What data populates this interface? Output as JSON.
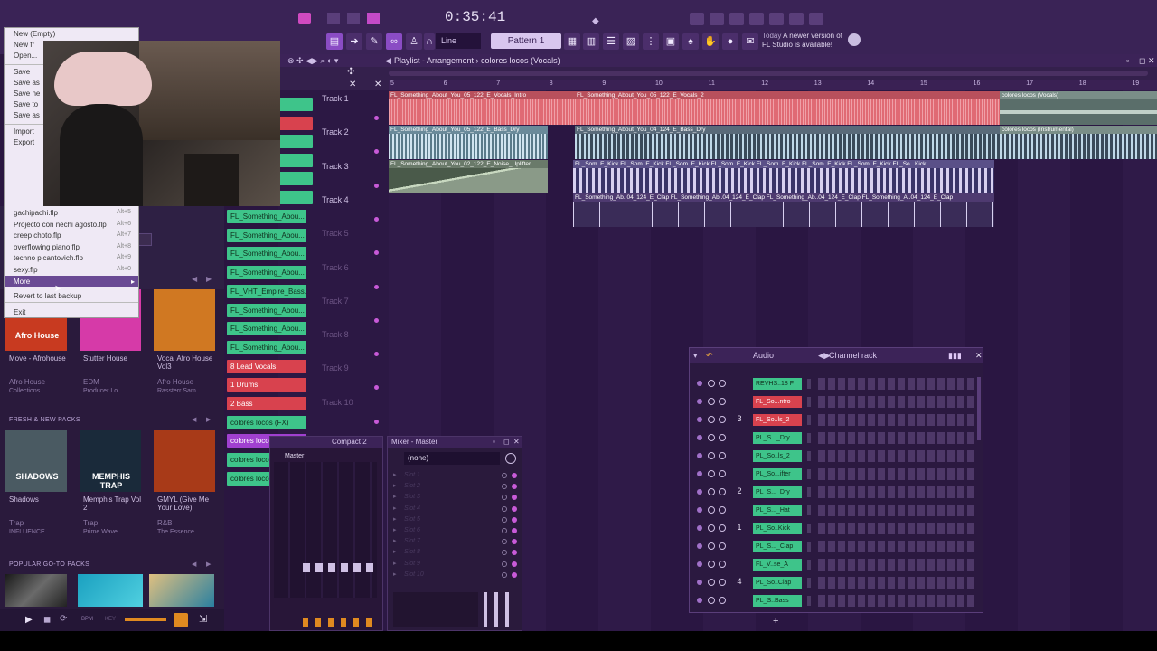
{
  "toolbar": {
    "time": "0:35:41",
    "pattern": "Pattern 1",
    "mode": "Line",
    "notice_line1": "Today",
    "notice_line2": "A newer version of",
    "notice_line3": "FL Studio is available!"
  },
  "file_menu": {
    "items": [
      {
        "label": "New (Empty)",
        "shortcut": ""
      },
      {
        "label": "New fr",
        "shortcut": ""
      },
      {
        "label": "Open...",
        "shortcut": ""
      },
      {
        "label": "Save",
        "shortcut": ""
      },
      {
        "label": "Save as",
        "shortcut": ""
      },
      {
        "label": "Save ne",
        "shortcut": ""
      },
      {
        "label": "Save to",
        "shortcut": ""
      },
      {
        "label": "Save as",
        "shortcut": ""
      },
      {
        "label": "Import",
        "shortcut": ""
      },
      {
        "label": "Export",
        "shortcut": ""
      }
    ],
    "recent": [
      {
        "label": "gachipachi.flp",
        "shortcut": "Alt+5"
      },
      {
        "label": "Projecto con nechi agosto.flp",
        "shortcut": "Alt+6"
      },
      {
        "label": "creep choto.flp",
        "shortcut": "Alt+7"
      },
      {
        "label": "overflowing piano.flp",
        "shortcut": "Alt+8"
      },
      {
        "label": "techno picantovich.flp",
        "shortcut": "Alt+9"
      },
      {
        "label": "sexy.flp",
        "shortcut": "Alt+0"
      }
    ],
    "more": "More",
    "revert": "Revert to last backup",
    "exit": "Exit"
  },
  "browser": {
    "packs_row1": [
      {
        "title": "Afro House",
        "name": "Move - Afrohouse",
        "genre": "Afro House",
        "sub": "Collections",
        "color": "#c83a20"
      },
      {
        "title": "",
        "name": "Stutter House",
        "genre": "EDM",
        "sub": "Producer Lo...",
        "color": "#d63aa8"
      },
      {
        "title": "",
        "name": "Vocal Afro House Vol3",
        "genre": "Afro House",
        "sub": "Rassterr Sam...",
        "color": "#d07822"
      }
    ],
    "fresh_header": "FRESH & NEW PACKS",
    "packs_row2": [
      {
        "title": "SHADOWS",
        "name": "Shadows",
        "genre": "Trap",
        "sub": "INFLUENCE",
        "color": "#4a5a62"
      },
      {
        "title": "MEMPHIS TRAP",
        "name": "Memphis Trap Vol 2",
        "genre": "Trap",
        "sub": "Prime Wave",
        "color": "#1a2a3a"
      },
      {
        "title": "",
        "name": "GMYL (Give Me Your Love)",
        "genre": "R&B",
        "sub": "The Essence",
        "color": "#a83a18"
      }
    ],
    "popular_header": "POPULAR GO-TO PACKS",
    "bpm": "BPM",
    "key": "KEY"
  },
  "channels": [
    {
      "label": "FL_Something_Abou...",
      "type": "green"
    },
    {
      "label": "FL_Something_Abou...",
      "type": "green"
    },
    {
      "label": "FL_Something_Abou...",
      "type": "green"
    },
    {
      "label": "FL_Something_Abou...",
      "type": "green"
    },
    {
      "label": "FL_VHT_Empire_Bass...",
      "type": "green"
    },
    {
      "label": "FL_Something_Abou...",
      "type": "green"
    },
    {
      "label": "FL_Something_Abou...",
      "type": "green"
    },
    {
      "label": "FL_Something_Abou...",
      "type": "green"
    },
    {
      "label": "8 Lead Vocals",
      "type": "red"
    },
    {
      "label": "1 Drums",
      "type": "red"
    },
    {
      "label": "2 Bass",
      "type": "red"
    },
    {
      "label": "colores locos (FX)",
      "type": "green"
    },
    {
      "label": "colores loco",
      "type": "purple"
    },
    {
      "label": "colores loco",
      "type": "green"
    },
    {
      "label": "colores loco",
      "type": "green"
    }
  ],
  "playlist": {
    "title": "Playlist - Arrangement › colores locos (Vocals)",
    "ruler": [
      "5",
      "6",
      "7",
      "8",
      "9",
      "10",
      "11",
      "12",
      "13",
      "14",
      "15",
      "16",
      "17",
      "18",
      "19"
    ],
    "tracks": [
      "Track 1",
      "Track 2",
      "Track 3",
      "Track 4",
      "Track 5",
      "Track 6",
      "Track 7",
      "Track 8",
      "Track 9",
      "Track 10"
    ],
    "clips": {
      "t1a": "FL_Something_About_You_05_122_E_Vocals_Intro",
      "t1b": "FL_Something_About_You_05_122_E_Vocals_2",
      "t1c": "colores locos (Vocals)",
      "t2a": "FL_Something_About_You_05_122_E_Bass_Dry",
      "t2b": "FL_Something_About_You_04_124_E_Bass_Dry",
      "t2c": "colores locos (Instrumental)",
      "t3a": "FL_Something_About_You_02_122_E_Noise_Uplifter",
      "t3b": "FL_Som..E_Kick  FL_Som..E_Kick  FL_Som..E_Kick  FL_Som..E_Kick  FL_Som..E_Kick  FL_Som..E_Kick  FL_Som..E_Kick  FL_So...Kick",
      "t3c": "FL_Something_Ab..04_124_E_Clap  FL_Something_Ab..04_124_E_Clap  FL_Something_Ab..04_124_E_Clap  FL_Something_A..04_124_E_Clap"
    }
  },
  "compact": {
    "title": "Compact 2",
    "master": "Master"
  },
  "mixer": {
    "title": "Mixer - Master",
    "preset": "(none)",
    "slots": [
      "Slot 1",
      "Slot 2",
      "Slot 3",
      "Slot 4",
      "Slot 5",
      "Slot 6",
      "Slot 7",
      "Slot 8",
      "Slot 9",
      "Slot 10"
    ]
  },
  "rack": {
    "title": "Channel rack",
    "filter": "Audio",
    "rows": [
      {
        "num": "",
        "label": "REVHS..18 F",
        "type": "green"
      },
      {
        "num": "",
        "label": "FL_So...ntro",
        "type": "red"
      },
      {
        "num": "3",
        "label": "FL_So..ls_2",
        "type": "red"
      },
      {
        "num": "",
        "label": "PL_S..._Dry",
        "type": "green"
      },
      {
        "num": "",
        "label": "PL_So..ls_2",
        "type": "green"
      },
      {
        "num": "",
        "label": "PL_So...ifter",
        "type": "green"
      },
      {
        "num": "2",
        "label": "PL_S..._Dry",
        "type": "green"
      },
      {
        "num": "",
        "label": "PL_S..._Hat",
        "type": "green"
      },
      {
        "num": "1",
        "label": "PL_So..Kick",
        "type": "green"
      },
      {
        "num": "",
        "label": "PL_S..._Clap",
        "type": "green"
      },
      {
        "num": "",
        "label": "FL_V..se_A",
        "type": "green"
      },
      {
        "num": "4",
        "label": "PL_So..Clap",
        "type": "green"
      },
      {
        "num": "",
        "label": "PL_S..Bass",
        "type": "green"
      }
    ]
  }
}
